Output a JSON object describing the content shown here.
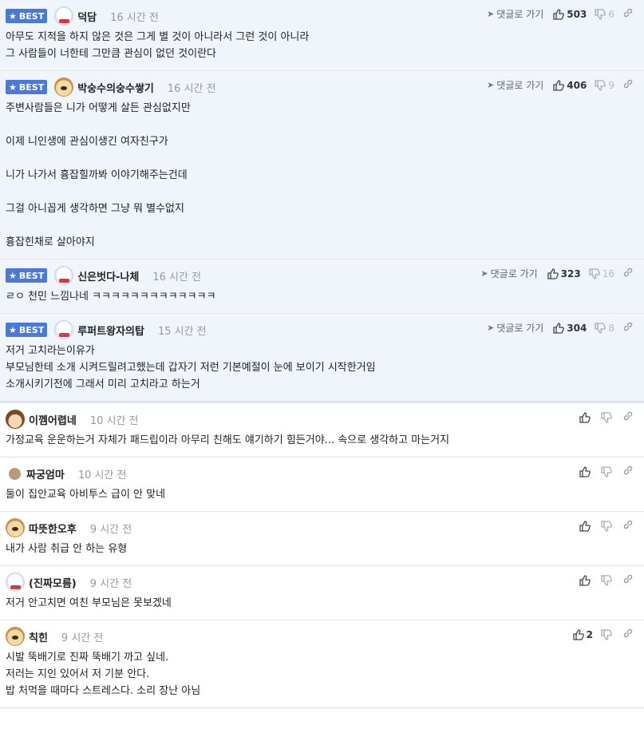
{
  "labels": {
    "best": "BEST",
    "goto": "댓글로 가기"
  },
  "comments": [
    {
      "best": true,
      "nick": "덕담",
      "time": "16 시간 전",
      "up": "503",
      "down": "6",
      "lines": [
        "아무도 지적을 하지 않은 것은 그게 별 것이 아니라서 그런 것이 아니라",
        "그 사람들이 너한테 그만큼 관심이 없던 것이란다"
      ]
    },
    {
      "best": true,
      "nick": "박숭수의숭수쌓기",
      "time": "16 시간 전",
      "up": "406",
      "down": "9",
      "lines": [
        "주변사람들은 니가 어떻게 살든 관심없지만",
        "",
        "이제 니인생에 관심이생긴 여자친구가",
        "",
        "니가 나가서 흉잡힐까봐 이야기해주는건데",
        "",
        "그걸 아니꼽게 생각하면 그냥 뭐 별수없지",
        "",
        "흉잡힌채로 살아야지"
      ]
    },
    {
      "best": true,
      "nick": "신은벗다-나체",
      "time": "16 시간 전",
      "up": "323",
      "down": "16",
      "lines": [
        "ㄹㅇ 천민 느낌나네 ㅋㅋㅋㅋㅋㅋㅋㅋㅋㅋㅋㅋㅋ"
      ]
    },
    {
      "best": true,
      "nick": "루퍼트왕자의탑",
      "time": "15 시간 전",
      "up": "304",
      "down": "8",
      "lines": [
        "저거 고치라는이유가",
        "부모님한테 소개 시켜드릴려고했는데 갑자기 저런 기본예절이 눈에 보이기 시작한거임",
        "소개시키기전에 그래서 미리 고치라고 하는거"
      ]
    },
    {
      "best": false,
      "nick": "이껨어렵네",
      "time": "10 시간 전",
      "up": "",
      "down": "",
      "lines": [
        "가정교육 운운하는거 자체가 패드립이라 아무리 친해도 얘기하기 힘든거야... 속으로 생각하고 마는거지"
      ]
    },
    {
      "best": false,
      "nick": "짜궁엄마",
      "time": "10 시간 전",
      "up": "",
      "down": "",
      "lines": [
        "둘이 집안교육 아비투스 급이 안 맞네"
      ]
    },
    {
      "best": false,
      "nick": "따뜻한오후",
      "time": "9 시간 전",
      "up": "",
      "down": "",
      "lines": [
        "내가 사람 취급 안 하는 유형"
      ]
    },
    {
      "best": false,
      "nick": "(진짜모름)",
      "time": "9 시간 전",
      "up": "",
      "down": "",
      "lines": [
        "저거 안고치면 여친 부모님은 못보겠네"
      ]
    },
    {
      "best": false,
      "nick": "칙힌",
      "time": "9 시간 전",
      "up": "2",
      "down": "",
      "lines": [
        "시발 뚝배기로 진짜 뚝배기 까고 싶네.",
        "저러는 지인 있어서 저 기분 안다.",
        "밥 처먹을 때마다 스트레스다. 소리 장난 아님"
      ]
    }
  ]
}
